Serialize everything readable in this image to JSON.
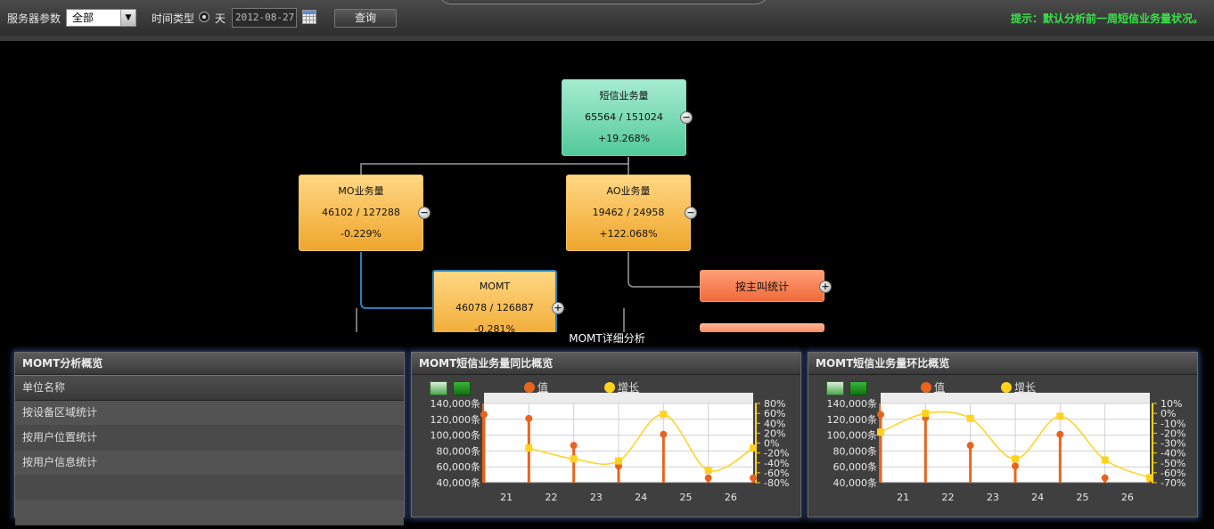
{
  "toolbar": {
    "server_param_label": "服务器参数",
    "server_param_value": "全部",
    "time_type_label": "时间类型",
    "radio_day_label": "天",
    "date_value": "2012-08-27",
    "query_button": "查询",
    "hint": "提示：默认分析前一周短信业务量状况。"
  },
  "tree": {
    "root": {
      "title": "短信业务量",
      "value": "65564 / 151024",
      "change": "+19.268%"
    },
    "mo": {
      "title": "MO业务量",
      "value": "46102 / 127288",
      "change": "-0.229%"
    },
    "ao": {
      "title": "AO业务量",
      "value": "19462 / 24958",
      "change": "+122.068%"
    },
    "momt": {
      "title": "MOMT",
      "value": "46078 / 126887",
      "change": "-0.281%"
    },
    "by_caller": "按主叫统计",
    "toggle_minus": "−",
    "toggle_plus": "+"
  },
  "detail_title": "MOMT详细分析",
  "overview_panel": {
    "title": "MOMT分析概览",
    "header": "单位名称",
    "rows": [
      "按设备区域统计",
      "按用户位置统计",
      "按用户信息统计"
    ]
  },
  "yoy_panel": {
    "title": "MOMT短信业务量同比概览",
    "legend_value": "值",
    "legend_growth": "增长"
  },
  "mom_panel": {
    "title": "MOMT短信业务量环比概览",
    "legend_value": "值",
    "legend_growth": "增长"
  },
  "chart_data": [
    {
      "type": "bar",
      "title": "MOMT短信业务量同比概览",
      "categories": [
        "21",
        "22",
        "23",
        "24",
        "25",
        "26"
      ],
      "y_ticks": [
        "140,000条",
        "120,000条",
        "100,000条",
        "80,000条",
        "60,000条",
        "40,000条"
      ],
      "y2_ticks": [
        "80%",
        "60%",
        "40%",
        "20%",
        "0%",
        "-20%",
        "-40%",
        "-60%",
        "-80%"
      ],
      "ylim": [
        40000,
        140000
      ],
      "y2lim": [
        -80,
        80
      ],
      "series": [
        {
          "name": "值",
          "x": [
            20.5,
            21.5,
            22.5,
            23.5,
            24.5,
            25.5,
            26.5
          ],
          "values": [
            126000,
            121000,
            87000,
            61000,
            101000,
            46000,
            46000
          ],
          "color": "#e8641e"
        },
        {
          "name": "增长",
          "x": [
            21.5,
            22.5,
            23.5,
            24.5,
            25.5,
            26.5
          ],
          "values": [
            -10,
            -32,
            -36,
            58,
            -55,
            -10
          ],
          "color": "#ffd21e"
        }
      ]
    },
    {
      "type": "bar",
      "title": "MOMT短信业务量环比概览",
      "categories": [
        "21",
        "22",
        "23",
        "24",
        "25",
        "26"
      ],
      "y_ticks": [
        "140,000条",
        "120,000条",
        "100,000条",
        "80,000条",
        "60,000条",
        "40,000条"
      ],
      "y2_ticks": [
        "10%",
        "0%",
        "-10%",
        "-20%",
        "-30%",
        "-40%",
        "-50%",
        "-60%",
        "-70%"
      ],
      "ylim": [
        40000,
        140000
      ],
      "y2lim": [
        -70,
        10
      ],
      "series": [
        {
          "name": "值",
          "x": [
            20.5,
            21.5,
            22.5,
            23.5,
            24.5,
            25.5,
            26.5
          ],
          "values": [
            126000,
            122000,
            87000,
            61000,
            101000,
            46000,
            46000
          ],
          "color": "#e8641e"
        },
        {
          "name": "增长",
          "x": [
            20.5,
            21.5,
            22.5,
            23.5,
            24.5,
            25.5,
            26.5
          ],
          "values": [
            -19,
            0,
            -5,
            -46,
            -3,
            -47,
            -65
          ],
          "color": "#ffd21e"
        }
      ]
    }
  ]
}
